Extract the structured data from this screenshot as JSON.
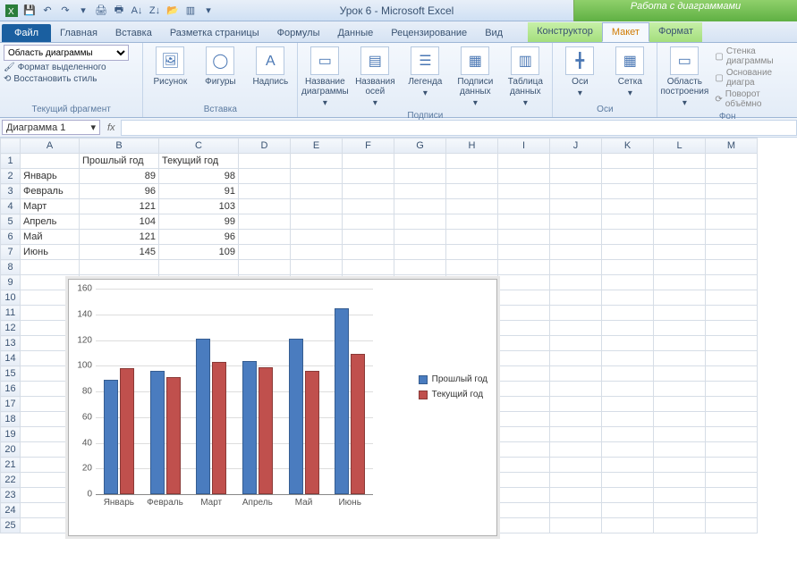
{
  "app": {
    "title": "Урок 6  -  Microsoft Excel"
  },
  "context_tools": {
    "label": "Работа с диаграммами"
  },
  "tabs": {
    "file": "Файл",
    "items": [
      "Главная",
      "Вставка",
      "Разметка страницы",
      "Формулы",
      "Данные",
      "Рецензирование",
      "Вид"
    ],
    "ctx": [
      "Конструктор",
      "Макет",
      "Формат"
    ],
    "active": "Макет"
  },
  "ribbon": {
    "frag": {
      "selector": "Область диаграммы",
      "format_sel": "Формат выделенного",
      "reset": "Восстановить стиль",
      "label": "Текущий фрагмент"
    },
    "insert": {
      "pic": "Рисунок",
      "shapes": "Фигуры",
      "textbox": "Надпись",
      "label": "Вставка"
    },
    "labels": {
      "title": "Название диаграммы",
      "axis_titles": "Названия осей",
      "legend": "Легенда",
      "data_labels": "Подписи данных",
      "data_table": "Таблица данных",
      "label": "Подписи"
    },
    "axes": {
      "axes": "Оси",
      "grid": "Сетка",
      "label": "Оси"
    },
    "bg": {
      "plotarea": "Область построения",
      "wall": "Стенка диаграммы",
      "floor": "Основание диагра",
      "rot3d": "Поворот объёмно",
      "label": "Фон"
    }
  },
  "namebox": "Диаграмма 1",
  "columns": [
    "A",
    "B",
    "C",
    "D",
    "E",
    "F",
    "G",
    "H",
    "I",
    "J",
    "K",
    "L",
    "M"
  ],
  "rows": 25,
  "table": {
    "header": [
      "",
      "Прошлый год",
      "Текущий год"
    ],
    "rows": [
      [
        "Январь",
        89,
        98
      ],
      [
        "Февраль",
        96,
        91
      ],
      [
        "Март",
        121,
        103
      ],
      [
        "Апрель",
        104,
        99
      ],
      [
        "Май",
        121,
        96
      ],
      [
        "Июнь",
        145,
        109
      ]
    ]
  },
  "chart_data": {
    "type": "bar",
    "categories": [
      "Январь",
      "Февраль",
      "Март",
      "Апрель",
      "Май",
      "Июнь"
    ],
    "series": [
      {
        "name": "Прошлый год",
        "color": "#4a7cbf",
        "values": [
          89,
          96,
          121,
          104,
          121,
          145
        ]
      },
      {
        "name": "Текущий год",
        "color": "#c0504d",
        "values": [
          98,
          91,
          103,
          99,
          96,
          109
        ]
      }
    ],
    "ylim": [
      0,
      160
    ],
    "ystep": 20,
    "title": "",
    "xlabel": "",
    "ylabel": ""
  }
}
